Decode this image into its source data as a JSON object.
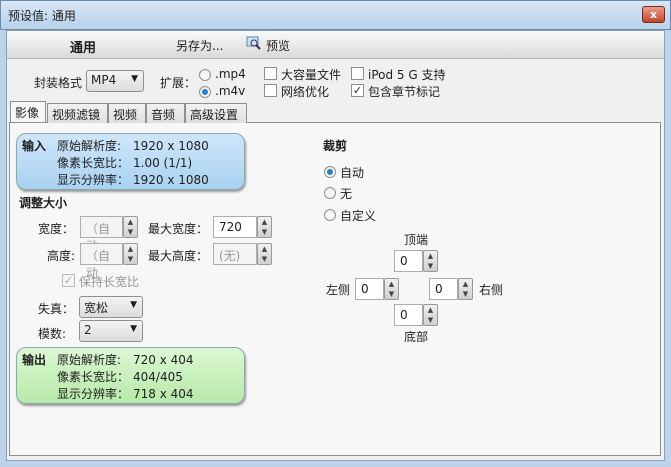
{
  "window": {
    "title": "预设值: 通用",
    "close_icon": "close-icon"
  },
  "toolbar": {
    "preset_name": "通用",
    "save_as": "另存为...",
    "preview": "预览"
  },
  "options": {
    "container_label": "封装格式",
    "container_value": "MP4",
    "ext_label": "扩展：",
    "ext_mp4": ".mp4",
    "ext_m4v": ".m4v",
    "ext_selected": ".m4v",
    "large_file": "大容量文件",
    "large_file_checked": false,
    "web_opt": "网络优化",
    "web_opt_checked": false,
    "ipod": "iPod 5 G 支持",
    "ipod_checked": false,
    "chapters": "包含章节标记",
    "chapters_checked": true
  },
  "tabs": [
    {
      "label": "影像",
      "active": true
    },
    {
      "label": "视频滤镜"
    },
    {
      "label": "视频"
    },
    {
      "label": "音频"
    },
    {
      "label": "高级设置"
    }
  ],
  "input": {
    "head": "输入",
    "rows": [
      {
        "k": "原始解析度:",
        "v": "1920 x 1080"
      },
      {
        "k": "像素长宽比：",
        "v": "1.00 (1/1)"
      },
      {
        "k": "显示分辨率：",
        "v": "1920 x 1080"
      }
    ]
  },
  "resize": {
    "title": "调整大小",
    "width_label": "宽度：",
    "width_value": "（自动",
    "height_label": "高度:",
    "height_value": "（自动",
    "max_width_label": "最大宽度：",
    "max_width_value": "720",
    "max_height_label": "最大高度：",
    "max_height_value": "(无)",
    "keep_aspect": "保持长宽比",
    "keep_aspect_checked": true,
    "anamorphic_label": "失真：",
    "anamorphic_value": "宽松",
    "modulus_label": "模数:",
    "modulus_value": "2"
  },
  "output": {
    "head": "输出",
    "rows": [
      {
        "k": "原始解析度:",
        "v": "720 x 404"
      },
      {
        "k": "像素长宽比：",
        "v": "404/405"
      },
      {
        "k": "显示分辨率：",
        "v": "718 x 404"
      }
    ]
  },
  "crop": {
    "title": "裁剪",
    "auto": "自动",
    "none": "无",
    "custom": "自定义",
    "selected": "自动",
    "top_label": "顶端",
    "top": "0",
    "left_label": "左侧",
    "left": "0",
    "right_label": "右侧",
    "right": "0",
    "bottom_label": "底部",
    "bottom": "0"
  }
}
